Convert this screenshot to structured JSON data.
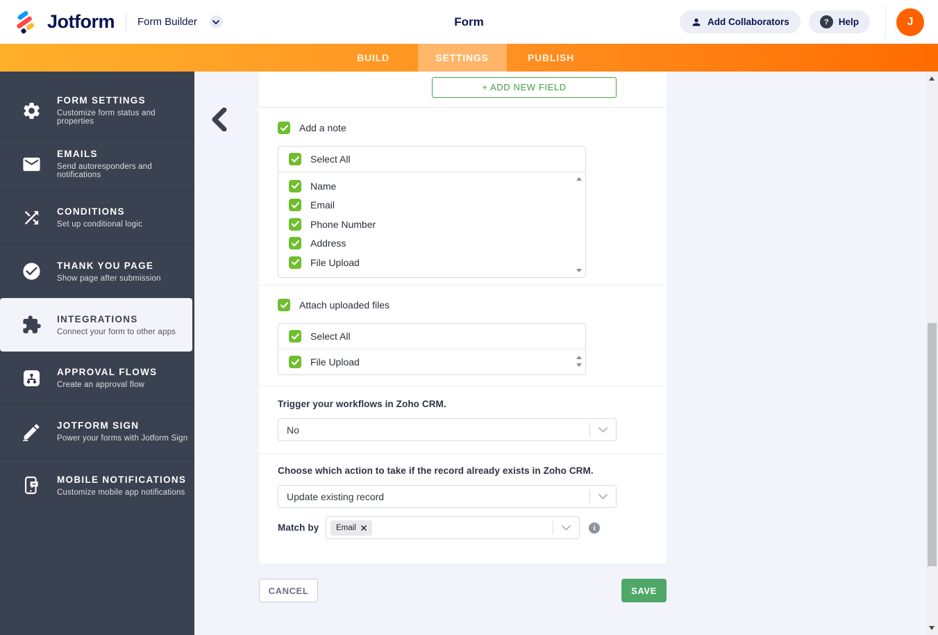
{
  "header": {
    "brand": "Jotform",
    "product": "Form Builder",
    "title": "Form",
    "add_collaborators_label": "Add Collaborators",
    "help_label": "Help",
    "help_icon_glyph": "?",
    "avatar_initial": "J"
  },
  "tabs": [
    {
      "label": "BUILD",
      "active": false
    },
    {
      "label": "SETTINGS",
      "active": true
    },
    {
      "label": "PUBLISH",
      "active": false
    }
  ],
  "sidebar": {
    "items": [
      {
        "title": "FORM SETTINGS",
        "subtitle": "Customize form status and properties",
        "icon": "gear-icon",
        "active": false
      },
      {
        "title": "EMAILS",
        "subtitle": "Send autoresponders and notifications",
        "icon": "envelope-icon",
        "active": false
      },
      {
        "title": "CONDITIONS",
        "subtitle": "Set up conditional logic",
        "icon": "shuffle-icon",
        "active": false
      },
      {
        "title": "THANK YOU PAGE",
        "subtitle": "Show page after submission",
        "icon": "check-circle-icon",
        "active": false
      },
      {
        "title": "INTEGRATIONS",
        "subtitle": "Connect your form to other apps",
        "icon": "puzzle-icon",
        "active": true
      },
      {
        "title": "APPROVAL FLOWS",
        "subtitle": "Create an approval flow",
        "icon": "approval-flow-icon",
        "active": false
      },
      {
        "title": "JOTFORM SIGN",
        "subtitle": "Power your forms with Jotform Sign",
        "icon": "sign-pen-icon",
        "active": false
      },
      {
        "title": "MOBILE NOTIFICATIONS",
        "subtitle": "Customize mobile app notifications",
        "icon": "mobile-notification-icon",
        "active": false
      }
    ]
  },
  "main": {
    "add_new_field_label": "+ ADD NEW FIELD",
    "add_a_note": {
      "label": "Add a note",
      "checked": true
    },
    "note_fields": {
      "select_all_label": "Select All",
      "select_all_checked": true,
      "options": [
        {
          "label": "Name",
          "checked": true
        },
        {
          "label": "Email",
          "checked": true
        },
        {
          "label": "Phone Number",
          "checked": true
        },
        {
          "label": "Address",
          "checked": true
        },
        {
          "label": "File Upload",
          "checked": true
        }
      ]
    },
    "attach_uploaded_files": {
      "label": "Attach uploaded files",
      "checked": true
    },
    "attach_fields": {
      "select_all_label": "Select All",
      "select_all_checked": true,
      "options": [
        {
          "label": "File Upload",
          "checked": true
        }
      ]
    },
    "trigger_workflows": {
      "label": "Trigger your workflows in Zoho CRM.",
      "value": "No"
    },
    "record_action": {
      "label": "Choose which action to take if the record already exists in Zoho CRM.",
      "value": "Update existing record"
    },
    "match_by": {
      "label": "Match by",
      "tags": [
        "Email"
      ]
    },
    "cancel_label": "CANCEL",
    "save_label": "SAVE"
  },
  "colors": {
    "brand_navy": "#0A1551",
    "orange_bar_left": "#FFB02A",
    "orange_bar_right": "#FF6C00",
    "active_tab": "#FFA55C",
    "sidebar_bg": "#3A4150",
    "checkbox_green": "#6FBE2D",
    "add_field_green": "#3F9E3F",
    "save_green": "#4FA768",
    "avatar_orange": "#FF6100",
    "content_bg": "#F3F4FB"
  }
}
